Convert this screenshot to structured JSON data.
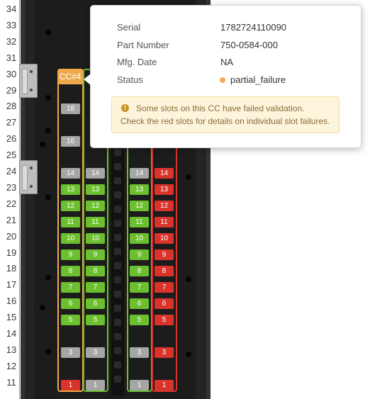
{
  "ruler": {
    "units": [
      "34",
      "33",
      "32",
      "31",
      "30",
      "29",
      "28",
      "27",
      "26",
      "25",
      "24",
      "23",
      "22",
      "21",
      "20",
      "19",
      "18",
      "17",
      "16",
      "15",
      "14",
      "13",
      "12",
      "11"
    ]
  },
  "cc": {
    "label": "CC#4"
  },
  "columns": [
    {
      "id": "col-1",
      "slots": [
        {
          "label": "18",
          "status": "gray"
        },
        {
          "label": "16",
          "status": "gray"
        },
        {
          "label": "14",
          "status": "gray"
        },
        {
          "label": "13",
          "status": "green"
        },
        {
          "label": "12",
          "status": "green"
        },
        {
          "label": "11",
          "status": "green"
        },
        {
          "label": "10",
          "status": "green"
        },
        {
          "label": "9",
          "status": "green"
        },
        {
          "label": "8",
          "status": "green"
        },
        {
          "label": "7",
          "status": "green"
        },
        {
          "label": "6",
          "status": "green"
        },
        {
          "label": "5",
          "status": "green"
        },
        {
          "label": "3",
          "status": "gray"
        },
        {
          "label": "1",
          "status": "red"
        }
      ]
    },
    {
      "id": "col-2",
      "slots": [
        {
          "label": "14",
          "status": "gray"
        },
        {
          "label": "13",
          "status": "green"
        },
        {
          "label": "12",
          "status": "green"
        },
        {
          "label": "11",
          "status": "green"
        },
        {
          "label": "10",
          "status": "green"
        },
        {
          "label": "9",
          "status": "green"
        },
        {
          "label": "8",
          "status": "green"
        },
        {
          "label": "7",
          "status": "green"
        },
        {
          "label": "6",
          "status": "green"
        },
        {
          "label": "5",
          "status": "green"
        },
        {
          "label": "3",
          "status": "gray"
        },
        {
          "label": "1",
          "status": "gray"
        }
      ]
    },
    {
      "id": "col-3",
      "slots": [
        {
          "label": "14",
          "status": "gray"
        },
        {
          "label": "13",
          "status": "green"
        },
        {
          "label": "12",
          "status": "green"
        },
        {
          "label": "11",
          "status": "green"
        },
        {
          "label": "10",
          "status": "green"
        },
        {
          "label": "9",
          "status": "green"
        },
        {
          "label": "8",
          "status": "green"
        },
        {
          "label": "7",
          "status": "green"
        },
        {
          "label": "6",
          "status": "green"
        },
        {
          "label": "5",
          "status": "green"
        },
        {
          "label": "3",
          "status": "gray"
        },
        {
          "label": "1",
          "status": "gray"
        }
      ]
    },
    {
      "id": "col-4",
      "slots": [
        {
          "label": "14",
          "status": "red"
        },
        {
          "label": "13",
          "status": "red"
        },
        {
          "label": "12",
          "status": "red"
        },
        {
          "label": "11",
          "status": "red"
        },
        {
          "label": "10",
          "status": "red"
        },
        {
          "label": "9",
          "status": "red"
        },
        {
          "label": "8",
          "status": "red"
        },
        {
          "label": "7",
          "status": "red"
        },
        {
          "label": "6",
          "status": "red"
        },
        {
          "label": "5",
          "status": "red"
        },
        {
          "label": "3",
          "status": "red"
        },
        {
          "label": "1",
          "status": "red"
        }
      ]
    }
  ],
  "tooltip": {
    "serial_label": "Serial",
    "serial_value": "1782724110090",
    "part_label": "Part Number",
    "part_value": "750-0584-000",
    "mfg_label": "Mfg. Date",
    "mfg_value": "NA",
    "status_label": "Status",
    "status_value": "partial_failure",
    "warning_line1": "Some slots on this CC have failed validation.",
    "warning_line2": "Check the red slots for details on individual slot failures."
  },
  "colors": {
    "green": "#6cbf2f",
    "red": "#d9342b",
    "gray": "#a6a6a6",
    "cc_orange": "#eea94a",
    "status_dot": "#f0ad4e"
  }
}
